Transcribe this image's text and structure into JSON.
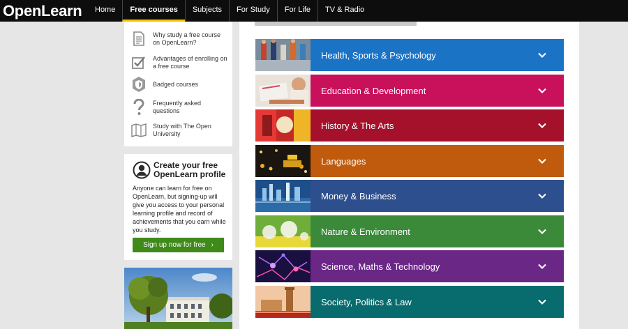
{
  "brand": {
    "logo": "OpenLearn"
  },
  "nav": {
    "items": [
      {
        "label": "Home"
      },
      {
        "label": "Free courses"
      },
      {
        "label": "Subjects"
      },
      {
        "label": "For Study"
      },
      {
        "label": "For Life"
      },
      {
        "label": "TV & Radio"
      }
    ],
    "active": "Free courses"
  },
  "sidebar": {
    "links": [
      {
        "label": "Why study a free course on OpenLearn?",
        "icon": "document-icon"
      },
      {
        "label": "Advantages of enrolling on a free course",
        "icon": "checkbox-icon"
      },
      {
        "label": "Badged courses",
        "icon": "badge-icon"
      },
      {
        "label": "Frequently asked questions",
        "icon": "question-icon"
      },
      {
        "label": "Study with The Open University",
        "icon": "map-icon"
      }
    ],
    "profile": {
      "title": "Create your free OpenLearn profile",
      "text": "Anyone can learn for free on OpenLearn, but signing-up will give you access to your personal learning profile and record of achievements that you earn while you study.",
      "button": "Sign up now for free",
      "button_arrow": "›",
      "icon": "user-icon"
    }
  },
  "subjects": [
    {
      "label": "Health, Sports & Psychology",
      "color": "#1a73c5"
    },
    {
      "label": "Education & Development",
      "color": "#c8105b"
    },
    {
      "label": "History & The Arts",
      "color": "#a5112a"
    },
    {
      "label": "Languages",
      "color": "#c05a0c"
    },
    {
      "label": "Money & Business",
      "color": "#2e4f8e"
    },
    {
      "label": "Nature & Environment",
      "color": "#3a8a3a"
    },
    {
      "label": "Science, Maths & Technology",
      "color": "#6a2786"
    },
    {
      "label": "Society, Politics & Law",
      "color": "#086b6d"
    }
  ],
  "colors": {
    "nav_bg": "#0d0d0d",
    "nav_active_underline": "#f4c400",
    "signup": "#3f8a1a"
  }
}
